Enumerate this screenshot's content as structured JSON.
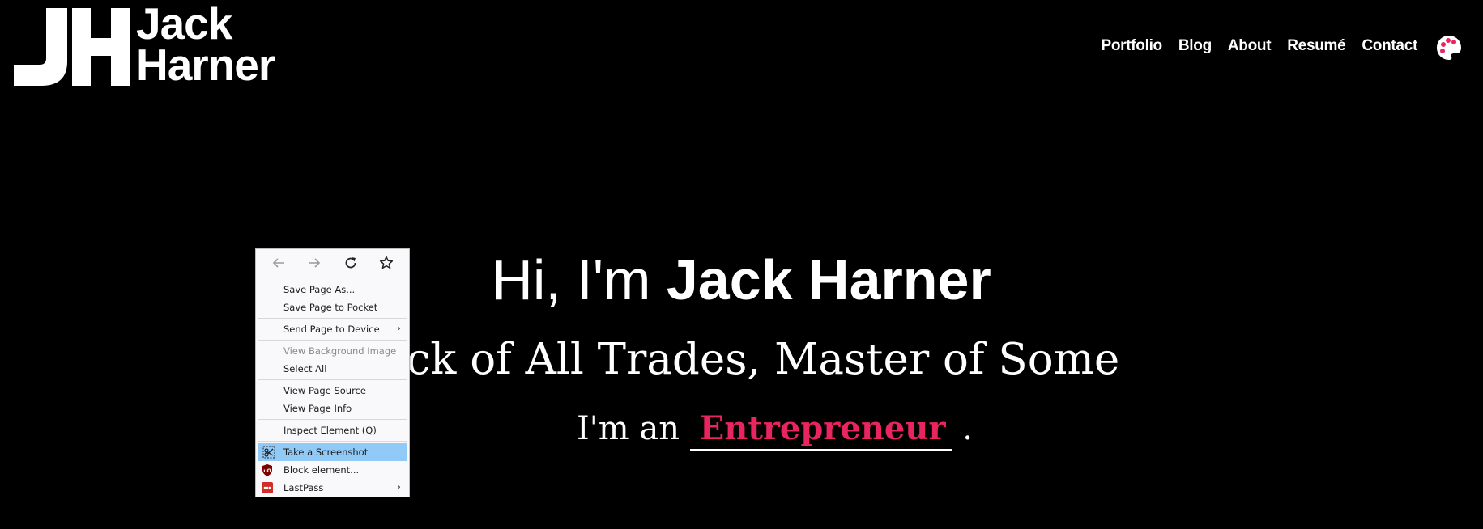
{
  "logo": {
    "monogram": "JH",
    "first": "Jack",
    "last": "Harner"
  },
  "nav": [
    {
      "label": "Portfolio"
    },
    {
      "label": "Blog"
    },
    {
      "label": "About"
    },
    {
      "label": "Resumé"
    },
    {
      "label": "Contact"
    }
  ],
  "hero": {
    "greeting": "Hi, I'm ",
    "name": "Jack Harner",
    "tagline": "Jack of All Trades, Master of Some",
    "role_prefix": "I'm an ",
    "role": "Entrepreneur",
    "role_suffix": " ."
  },
  "colors": {
    "accent": "#e8255f",
    "background": "#000000",
    "menu_highlight": "#91c9f7"
  },
  "context_menu": {
    "nav_icons": [
      "back-icon",
      "forward-icon",
      "reload-icon",
      "bookmark-star-icon"
    ],
    "items": [
      {
        "label": "Save Page As..."
      },
      {
        "label": "Save Page to Pocket"
      },
      {
        "label": "Send Page to Device"
      },
      {
        "label": "View Background Image"
      },
      {
        "label": "Select All"
      },
      {
        "label": "View Page Source"
      },
      {
        "label": "View Page Info"
      },
      {
        "label": "Inspect Element (Q)"
      },
      {
        "label": "Take a Screenshot"
      },
      {
        "label": "Block element..."
      },
      {
        "label": "LastPass"
      }
    ],
    "submenu_arrow": "›"
  }
}
